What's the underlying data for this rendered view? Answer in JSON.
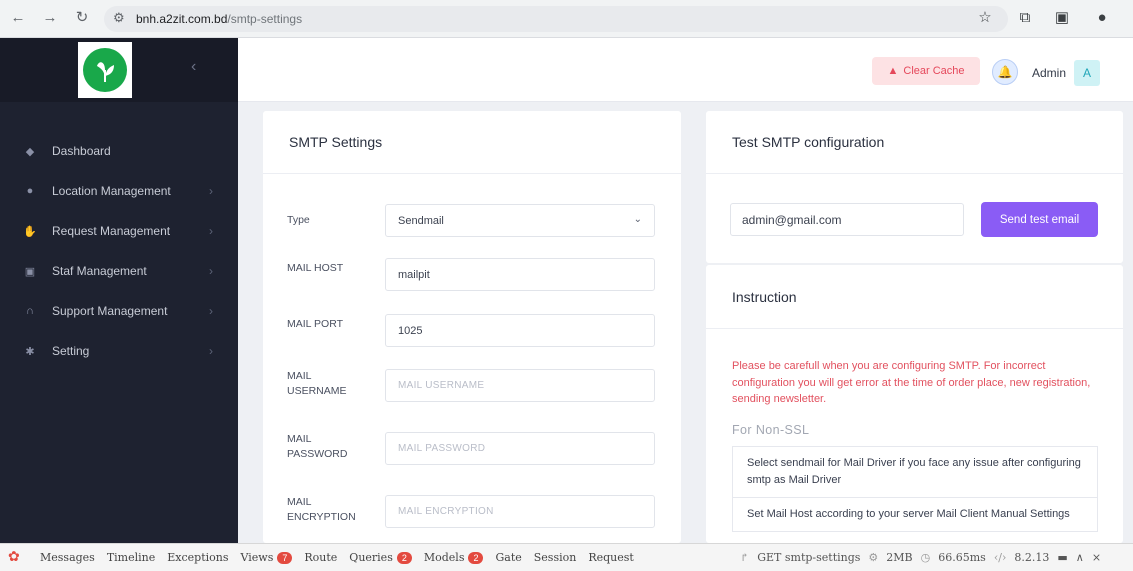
{
  "browser": {
    "url_host": "bnh.a2zit.com.bd",
    "url_path": "/smtp-settings",
    "icons": [
      "back-icon",
      "forward-icon",
      "reload-icon",
      "site-settings-icon",
      "bookmark-star-icon",
      "extensions-icon",
      "sidebar-icon",
      "profile-icon"
    ]
  },
  "sidebar": {
    "collapse_glyph": "‹",
    "items": [
      {
        "label": "Dashboard",
        "icon": "diamond-icon"
      },
      {
        "label": "Location Management",
        "icon": "location-pin-icon"
      },
      {
        "label": "Request Management",
        "icon": "handshake-icon"
      },
      {
        "label": "Staf Management",
        "icon": "id-card-icon"
      },
      {
        "label": "Support Management",
        "icon": "headset-icon"
      },
      {
        "label": "Setting",
        "icon": "gear-icon"
      }
    ]
  },
  "header": {
    "clear_cache_label": "Clear Cache",
    "admin_label": "Admin",
    "avatar_letter": "A"
  },
  "smtp": {
    "title": "SMTP Settings",
    "fields": {
      "type": {
        "label": "Type",
        "value": "Sendmail"
      },
      "host": {
        "label": "MAIL HOST",
        "value": "mailpit"
      },
      "port": {
        "label": "MAIL PORT",
        "value": "1025"
      },
      "username": {
        "label_1": "MAIL",
        "label_2": "USERNAME",
        "placeholder": "MAIL USERNAME"
      },
      "password": {
        "label_1": "MAIL",
        "label_2": "PASSWORD",
        "placeholder": "MAIL PASSWORD"
      },
      "encryption": {
        "label_1": "MAIL",
        "label_2": "ENCRYPTION",
        "placeholder": "MAIL ENCRYPTION"
      }
    }
  },
  "test": {
    "title": "Test SMTP configuration",
    "email_value": "admin@gmail.com",
    "send_label": "Send test email"
  },
  "instruction": {
    "title": "Instruction",
    "warning": "Please be carefull when you are configuring SMTP. For incorrect configuration you will get error at the time of order place, new registration, sending newsletter.",
    "non_ssl_label": "For Non-SSL",
    "items": [
      "Select sendmail for Mail Driver if you face any issue after configuring smtp as Mail Driver",
      "Set Mail Host according to your server Mail Client Manual Settings"
    ]
  },
  "debugbar": {
    "tabs": [
      {
        "label": "Messages",
        "badge": ""
      },
      {
        "label": "Timeline",
        "badge": ""
      },
      {
        "label": "Exceptions",
        "badge": ""
      },
      {
        "label": "Views",
        "badge": "7"
      },
      {
        "label": "Route",
        "badge": ""
      },
      {
        "label": "Queries",
        "badge": "2"
      },
      {
        "label": "Models",
        "badge": "2"
      },
      {
        "label": "Gate",
        "badge": ""
      },
      {
        "label": "Session",
        "badge": ""
      },
      {
        "label": "Request",
        "badge": ""
      }
    ],
    "route": "GET smtp-settings",
    "memory": "2MB",
    "time": "66.65ms",
    "php_version": "8.2.13"
  },
  "colors": {
    "sidebar_bg": "#1e2230",
    "accent_purple": "#8a5cf5",
    "danger": "#e5485b",
    "warning_text": "#e2515f"
  }
}
